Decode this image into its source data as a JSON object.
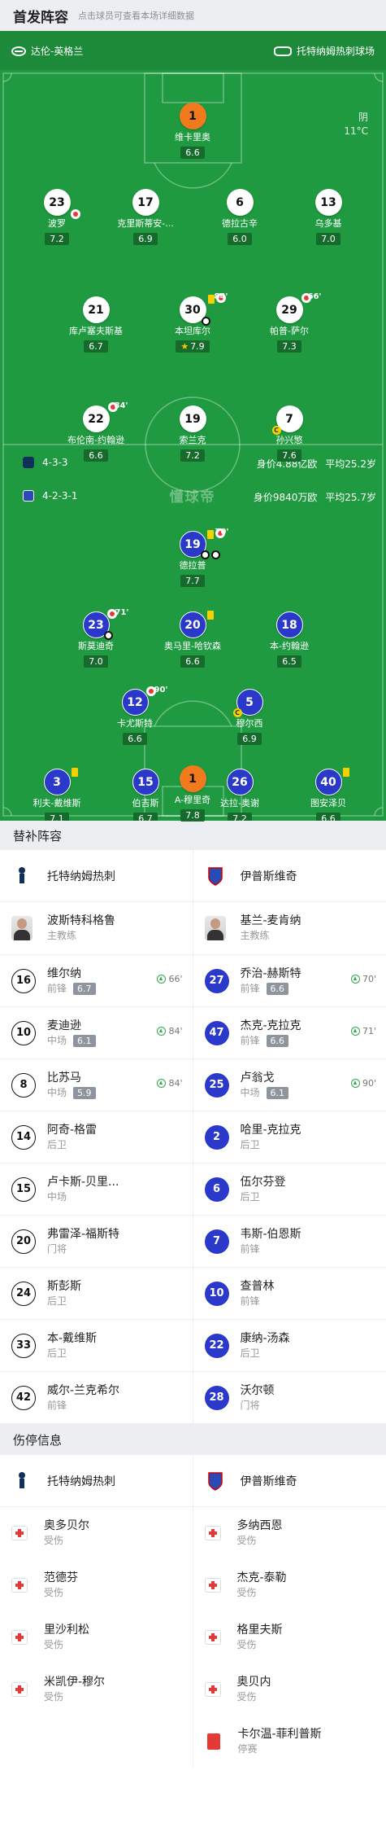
{
  "lineup": {
    "title": "首发阵容",
    "hint": "点击球员可查看本场详细数据"
  },
  "match": {
    "referee": "达伦-英格兰",
    "stadium": "托特纳姆热刺球场",
    "weather": "阴",
    "temperature": "11°C",
    "watermark": "懂球帝"
  },
  "home": {
    "name": "托特纳姆热刺",
    "formation": "4-3-3",
    "value": "身价4.88亿欧",
    "avg_age": "平均25.2岁",
    "color": "#ffffff"
  },
  "away": {
    "name": "伊普斯维奇",
    "formation": "4-2-3-1",
    "value": "身价9840万欧",
    "avg_age": "平均25.7岁",
    "color": "#2a39c9"
  },
  "home_players": [
    {
      "num": "1",
      "name": "维卡里奥",
      "rating": "6.6"
    },
    {
      "num": "23",
      "name": "波罗",
      "rating": "7.2"
    },
    {
      "num": "17",
      "name": "克里斯蒂安-...",
      "rating": "6.9"
    },
    {
      "num": "6",
      "name": "德拉古辛",
      "rating": "6.0"
    },
    {
      "num": "13",
      "name": "乌多基",
      "rating": "7.0"
    },
    {
      "num": "30",
      "name": "本坦库尔",
      "rating": "7.9",
      "sub_time": "84'"
    },
    {
      "num": "29",
      "name": "帕普-萨尔",
      "rating": "7.3",
      "sub_time": "66'"
    },
    {
      "num": "21",
      "name": "库卢塞夫斯基",
      "rating": "6.7"
    },
    {
      "num": "22",
      "name": "布伦南-约翰逊",
      "rating": "6.6",
      "sub_time": "84'"
    },
    {
      "num": "19",
      "name": "索兰克",
      "rating": "7.2"
    },
    {
      "num": "7",
      "name": "孙兴慜",
      "rating": "7.6"
    }
  ],
  "away_players": [
    {
      "num": "19",
      "name": "德拉普",
      "rating": "7.7",
      "sub_time": "70'"
    },
    {
      "num": "23",
      "name": "斯莫迪奇",
      "rating": "7.0",
      "sub_time": "71'"
    },
    {
      "num": "20",
      "name": "奥马里-哈钦森",
      "rating": "6.6"
    },
    {
      "num": "18",
      "name": "本-约翰逊",
      "rating": "6.5"
    },
    {
      "num": "12",
      "name": "卡尤斯特",
      "rating": "6.6",
      "sub_time": "90'"
    },
    {
      "num": "5",
      "name": "穆尔西",
      "rating": "6.9"
    },
    {
      "num": "3",
      "name": "利夫-戴维斯",
      "rating": "7.1"
    },
    {
      "num": "15",
      "name": "伯吉斯",
      "rating": "6.7"
    },
    {
      "num": "26",
      "name": "达拉-奥谢",
      "rating": "7.2"
    },
    {
      "num": "40",
      "name": "图安泽贝",
      "rating": "6.6"
    },
    {
      "num": "1",
      "name": "A-穆里奇",
      "rating": "7.8"
    }
  ],
  "subs": {
    "title": "替补阵容",
    "home_coach": {
      "name": "波斯特科格鲁",
      "role": "主教练"
    },
    "away_coach": {
      "name": "基兰-麦肯纳",
      "role": "主教练"
    },
    "home": [
      {
        "num": "16",
        "name": "维尔纳",
        "pos": "前锋",
        "rating": "6.7",
        "in": "66'"
      },
      {
        "num": "10",
        "name": "麦迪逊",
        "pos": "中场",
        "rating": "6.1",
        "in": "84'"
      },
      {
        "num": "8",
        "name": "比苏马",
        "pos": "中场",
        "rating": "5.9",
        "in": "84'"
      },
      {
        "num": "14",
        "name": "阿奇-格雷",
        "pos": "后卫"
      },
      {
        "num": "15",
        "name": "卢卡斯-贝里...",
        "pos": "中场"
      },
      {
        "num": "20",
        "name": "弗雷泽-福斯特",
        "pos": "门将"
      },
      {
        "num": "24",
        "name": "斯彭斯",
        "pos": "后卫"
      },
      {
        "num": "33",
        "name": "本-戴维斯",
        "pos": "后卫"
      },
      {
        "num": "42",
        "name": "威尔-兰克希尔",
        "pos": "前锋"
      }
    ],
    "away": [
      {
        "num": "27",
        "name": "乔治-赫斯特",
        "pos": "前锋",
        "rating": "6.6",
        "in": "70'"
      },
      {
        "num": "47",
        "name": "杰克-克拉克",
        "pos": "前锋",
        "rating": "6.6",
        "in": "71'"
      },
      {
        "num": "25",
        "name": "卢翁戈",
        "pos": "中场",
        "rating": "6.1",
        "in": "90'"
      },
      {
        "num": "2",
        "name": "哈里-克拉克",
        "pos": "后卫"
      },
      {
        "num": "6",
        "name": "伍尔芬登",
        "pos": "后卫"
      },
      {
        "num": "7",
        "name": "韦斯-伯恩斯",
        "pos": "前锋"
      },
      {
        "num": "10",
        "name": "查普林",
        "pos": "前锋"
      },
      {
        "num": "22",
        "name": "康纳-汤森",
        "pos": "后卫"
      },
      {
        "num": "28",
        "name": "沃尔顿",
        "pos": "门将"
      }
    ]
  },
  "injuries": {
    "title": "伤停信息",
    "home": [
      {
        "name": "奥多贝尔",
        "status": "受伤"
      },
      {
        "name": "范德芬",
        "status": "受伤"
      },
      {
        "name": "里沙利松",
        "status": "受伤"
      },
      {
        "name": "米凯伊-穆尔",
        "status": "受伤"
      }
    ],
    "away": [
      {
        "name": "多纳西恩",
        "status": "受伤"
      },
      {
        "name": "杰克-泰勒",
        "status": "受伤"
      },
      {
        "name": "格里夫斯",
        "status": "受伤"
      },
      {
        "name": "奥贝内",
        "status": "受伤"
      },
      {
        "name": "卡尔温-菲利普斯",
        "status": "停赛"
      }
    ]
  }
}
